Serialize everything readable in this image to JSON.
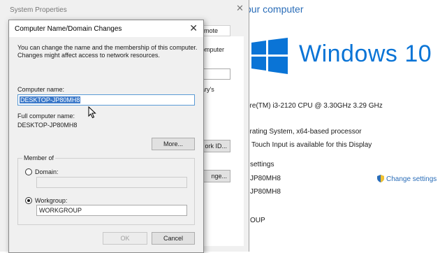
{
  "background_panel": {
    "heading": "our computer",
    "windows_logo_text": "Windows 10",
    "processor": "ore(TM) i3-2120 CPU @ 3.30GHz   3.29 GHz",
    "system_type": "erating System, x64-based processor",
    "pen_touch": "Touch Input is available for this Display",
    "settings_heading": "settings",
    "computer_name": "JP80MH8",
    "full_computer_name": "JP80MH8",
    "workgroup": "OUP",
    "change_settings_link": "Change settings",
    "accent_color": "#0a74d6"
  },
  "system_properties": {
    "title": "System Properties",
    "tab_label": "emote",
    "partial_text_1": "omputer",
    "partial_text_2": "ary's",
    "network_id_button": "ork ID...",
    "change_button": "nge..."
  },
  "dialog": {
    "title": "Computer Name/Domain Changes",
    "description": "You can change the name and the membership of this computer. Changes might affect access to network resources.",
    "computer_name_label": "Computer name:",
    "computer_name_value": "DESKTOP-JP80MH8",
    "full_name_label": "Full computer name:",
    "full_name_value": "DESKTOP-JP80MH8",
    "more_button": "More...",
    "member_of_label": "Member of",
    "domain_label": "Domain:",
    "domain_value": "",
    "workgroup_label": "Workgroup:",
    "workgroup_value": "WORKGROUP",
    "selected_membership": "workgroup",
    "ok_button": "OK",
    "cancel_button": "Cancel"
  }
}
